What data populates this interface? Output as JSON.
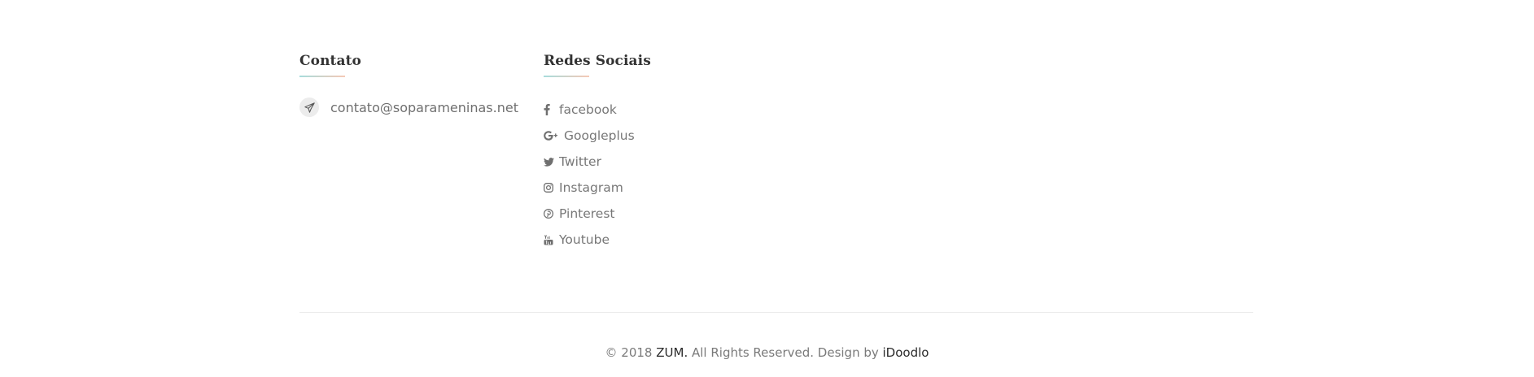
{
  "contact": {
    "title": "Contato",
    "email": "contato@soparameninas.net",
    "icon": "paper-plane-icon"
  },
  "social": {
    "title": "Redes Sociais",
    "items": [
      {
        "label": "facebook",
        "icon": "facebook-icon"
      },
      {
        "label": "Googleplus",
        "icon": "google-plus-icon"
      },
      {
        "label": "Twitter",
        "icon": "twitter-icon"
      },
      {
        "label": "Instagram",
        "icon": "instagram-icon"
      },
      {
        "label": "Pinterest",
        "icon": "pinterest-icon"
      },
      {
        "label": "Youtube",
        "icon": "youtube-icon"
      }
    ]
  },
  "footer": {
    "copyright_prefix": "© 2018 ",
    "brand": "ZUM.",
    "copyright_middle": " All Rights Reserved. Design by ",
    "designer": "iDoodlo"
  },
  "colors": {
    "underline_start": "#a7dcdc",
    "underline_end": "#f6c9b6",
    "text_muted": "#777777",
    "text_dark": "#333333"
  }
}
